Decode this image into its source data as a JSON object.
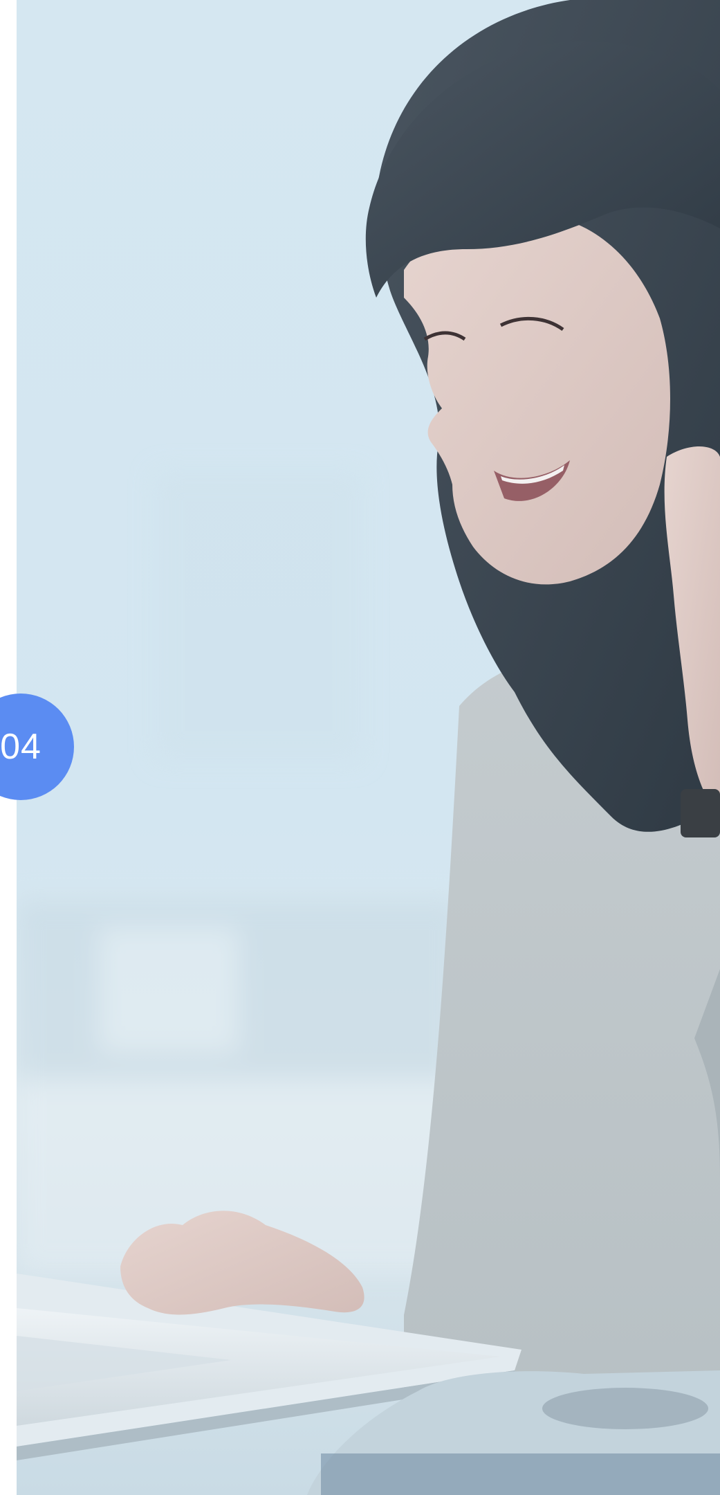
{
  "slide": {
    "step_number": "04",
    "accent_color": "#5b8cf2",
    "photo_description_icon": "woman-at-laptop-photo"
  }
}
